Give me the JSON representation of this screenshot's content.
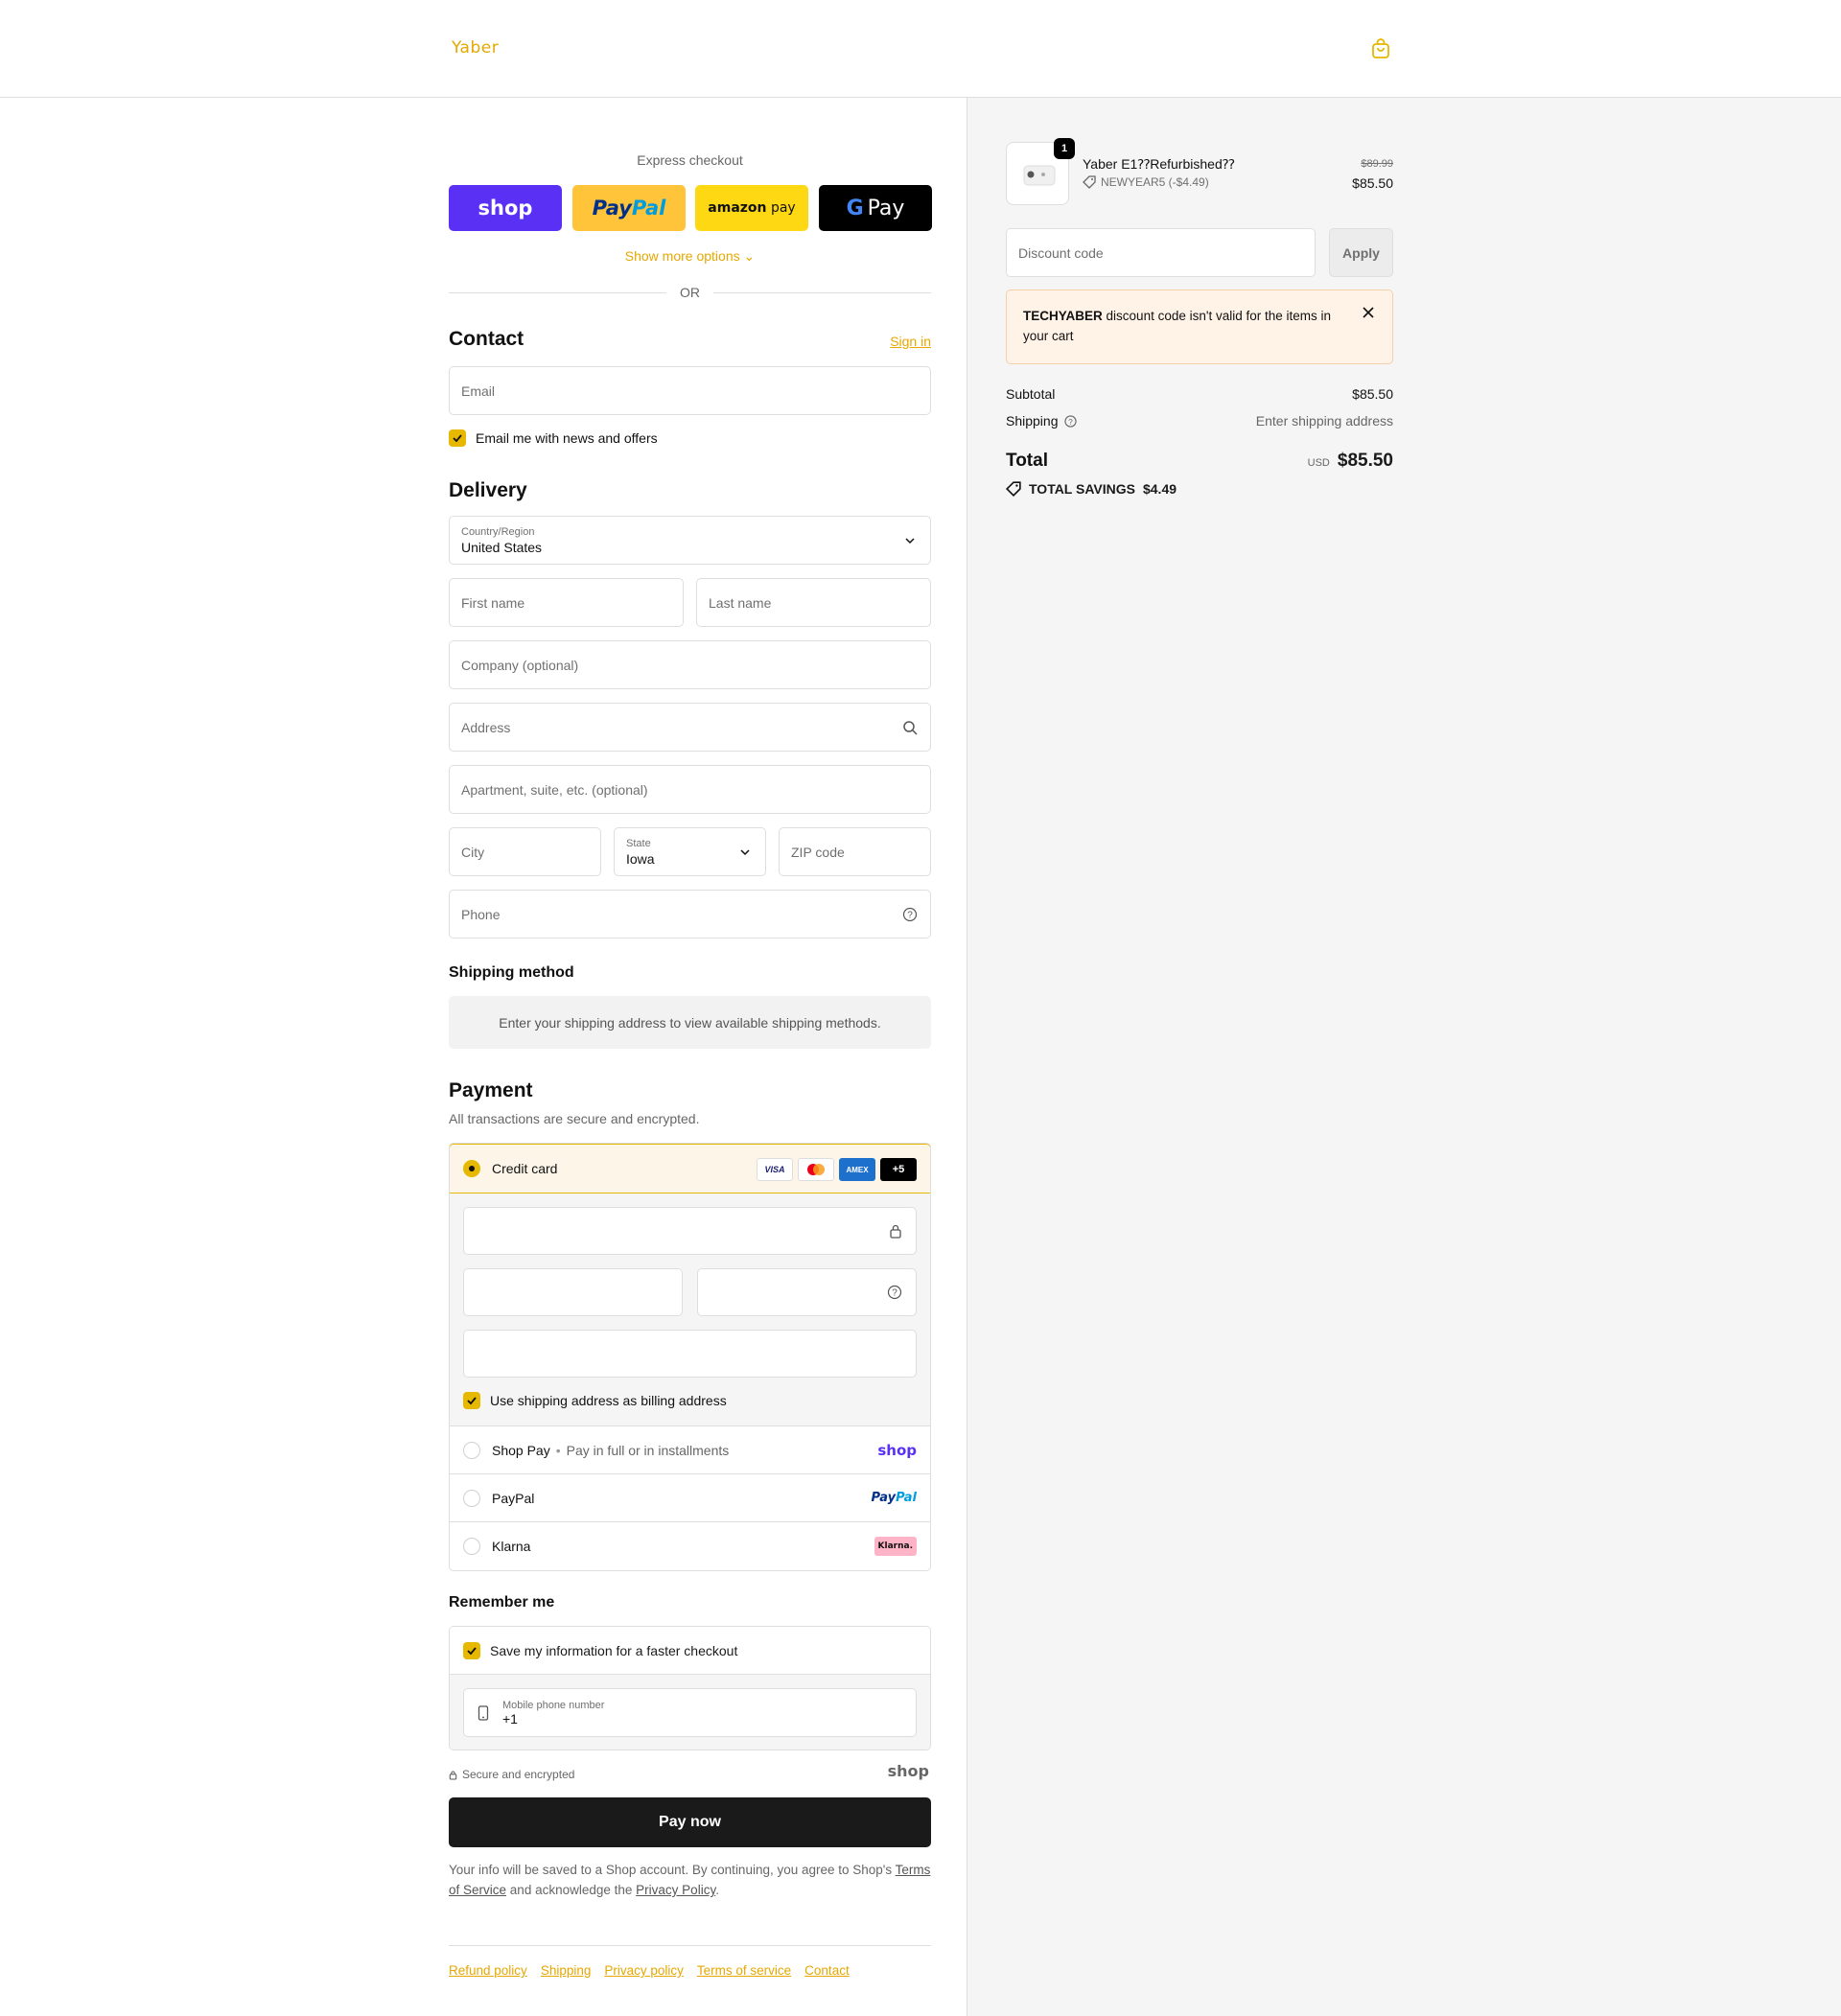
{
  "header": {
    "logo": "Yaber"
  },
  "express": {
    "title": "Express checkout",
    "shop_label": "shop",
    "paypal_pay": "Pay",
    "paypal_pal": "Pal",
    "amazon_brand": "amazon",
    "amazon_pay": "pay",
    "gpay_g": "G",
    "gpay_pay": "Pay",
    "show_more": "Show more options",
    "or": "OR"
  },
  "contact": {
    "title": "Contact",
    "sign_in": "Sign in",
    "email_placeholder": "Email",
    "news_label": "Email me with news and offers"
  },
  "delivery": {
    "title": "Delivery",
    "country_label": "Country/Region",
    "country_value": "United States",
    "first_name": "First name",
    "last_name": "Last name",
    "company": "Company (optional)",
    "address": "Address",
    "apartment": "Apartment, suite, etc. (optional)",
    "city": "City",
    "state_label": "State",
    "state_value": "Iowa",
    "zip": "ZIP code",
    "phone": "Phone"
  },
  "shipping_method": {
    "title": "Shipping method",
    "message": "Enter your shipping address to view available shipping methods."
  },
  "payment": {
    "title": "Payment",
    "subtitle": "All transactions are secure and encrypted.",
    "credit_card": "Credit card",
    "brands": {
      "visa": "VISA",
      "amex": "AMEX",
      "more": "+5"
    },
    "billing_label": "Use shipping address as billing address",
    "shop_pay": "Shop Pay",
    "shop_pay_dot": "•",
    "shop_pay_desc": "Pay in full or in installments",
    "shop_logo": "shop",
    "paypal": "PayPal",
    "paypal_logo_pay": "Pay",
    "paypal_logo_pal": "Pal",
    "klarna": "Klarna",
    "klarna_logo": "Klarna."
  },
  "remember": {
    "title": "Remember me",
    "save_label": "Save my information for a faster checkout",
    "mobile_label": "Mobile phone number",
    "mobile_value": "+1",
    "secure": "Secure and encrypted",
    "shop_logo": "shop"
  },
  "pay_now": "Pay now",
  "legal": {
    "text1": "Your info will be saved to a Shop account. By continuing, you agree to Shop's",
    "terms": "Terms of Service",
    "text2": "and acknowledge the",
    "privacy": "Privacy Policy",
    "text3": "."
  },
  "footer": [
    "Refund policy",
    "Shipping",
    "Privacy policy",
    "Terms of service",
    "Contact"
  ],
  "order": {
    "quantity": "1",
    "product_name": "Yaber E1⁇Refurbished⁇",
    "discount_tag": "NEWYEAR5 (-$4.49)",
    "original_price": "$89.99",
    "price": "$85.50",
    "discount_placeholder": "Discount code",
    "apply": "Apply",
    "alert_code": "TECHYABER",
    "alert_text": "discount code isn't valid for the items in your cart",
    "subtotal_label": "Subtotal",
    "subtotal_value": "$85.50",
    "shipping_label": "Shipping",
    "shipping_value": "Enter shipping address",
    "total_label": "Total",
    "currency": "USD",
    "total_value": "$85.50",
    "savings_label": "TOTAL SAVINGS",
    "savings_value": "$4.49"
  },
  "colors": {
    "accent": "#e6b800",
    "shop": "#5a31f4",
    "paypal": "#ffc439",
    "amazon": "#ffd814"
  }
}
